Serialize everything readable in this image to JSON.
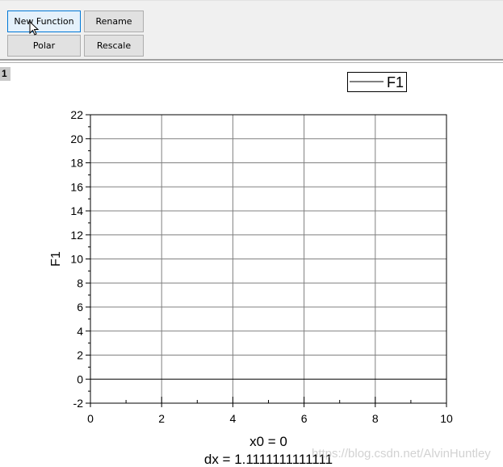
{
  "toolbar": {
    "buttons": [
      {
        "label": "New Function",
        "state": "hover"
      },
      {
        "label": "Rename"
      },
      {
        "label": "Polar"
      },
      {
        "label": "Rescale"
      }
    ]
  },
  "panel_tag": "1",
  "watermark": "https://blog.csdn.net/AlvinHuntley",
  "chart_data": {
    "type": "line",
    "ylabel": "F1",
    "xlim": [
      0,
      10
    ],
    "ylim": [
      -2,
      22
    ],
    "xticks": [
      0,
      2,
      4,
      6,
      8,
      10
    ],
    "yticks": [
      -2,
      0,
      2,
      4,
      6,
      8,
      10,
      12,
      14,
      16,
      18,
      20,
      22
    ],
    "grid": true,
    "legend": {
      "entries": [
        "F1"
      ],
      "placement": "top-right"
    },
    "series": [
      {
        "name": "F1",
        "x": [],
        "y": []
      }
    ],
    "annotations": [
      "x0 = 0",
      "dx = 1.1111111111111"
    ],
    "colors": {
      "grid": "#808080",
      "axis": "#000000"
    }
  }
}
